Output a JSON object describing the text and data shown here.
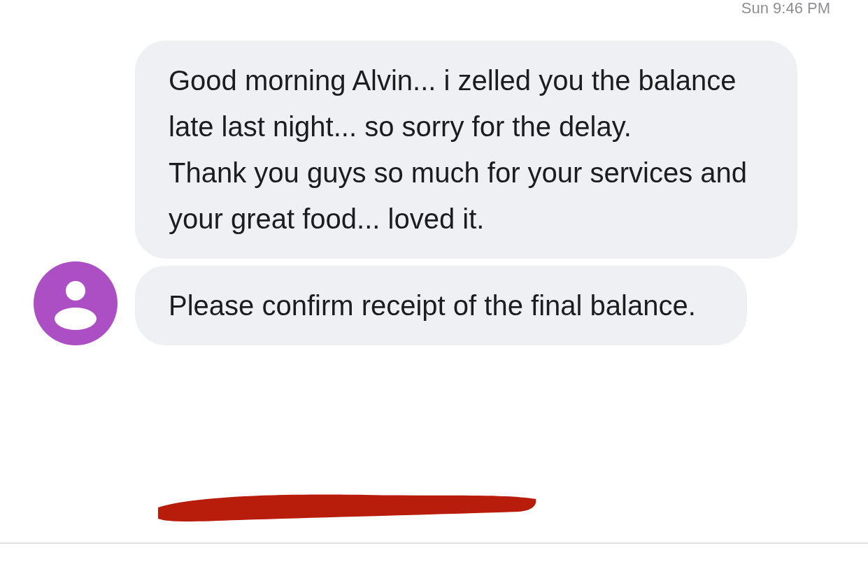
{
  "timestamp": "Sun 9:46 PM",
  "messages": [
    {
      "text": "Good morning Alvin... i zelled you the balance late last night... so sorry for the delay.\nThank you guys so much for your services and your great food... loved it."
    },
    {
      "text": "Please confirm receipt of the final balance."
    }
  ]
}
